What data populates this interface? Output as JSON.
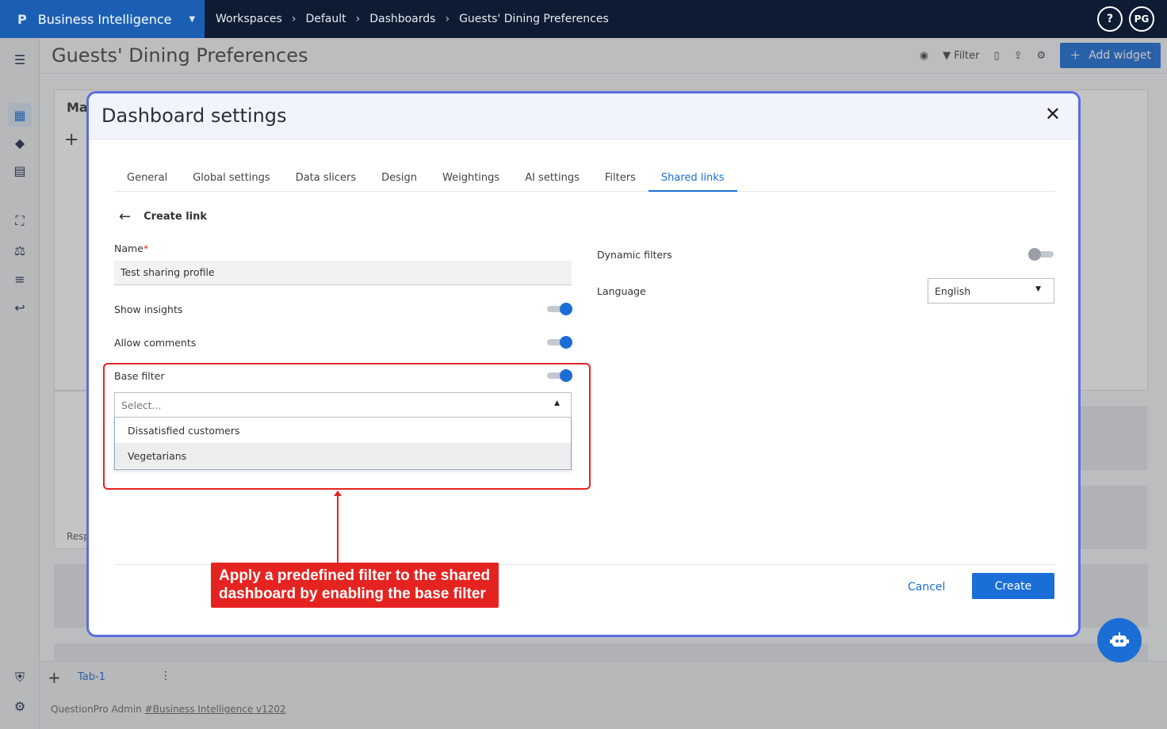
{
  "topbar": {
    "app_name": "Business Intelligence",
    "breadcrumbs": [
      "Workspaces",
      "Default",
      "Dashboards",
      "Guests' Dining Preferences"
    ],
    "help_label": "?",
    "avatar_initials": "PG"
  },
  "subheader": {
    "page_title": "Guests' Dining Preferences",
    "filter_label": "Filter",
    "add_widget_label": "Add widget"
  },
  "background": {
    "widget_title_fragment": "Ma",
    "widget_footer_fragment": "Resp",
    "tab_name": "Tab-1",
    "footer_text": "QuestionPro Admin ",
    "footer_link": "#Business Intelligence v1202"
  },
  "modal": {
    "title": "Dashboard settings",
    "close_label": "✕",
    "tabs": [
      {
        "label": "General",
        "active": false
      },
      {
        "label": "Global settings",
        "active": false
      },
      {
        "label": "Data slicers",
        "active": false
      },
      {
        "label": "Design",
        "active": false
      },
      {
        "label": "Weightings",
        "active": false
      },
      {
        "label": "AI settings",
        "active": false
      },
      {
        "label": "Filters",
        "active": false
      },
      {
        "label": "Shared links",
        "active": true
      }
    ],
    "create_link_label": "Create link",
    "name_label": "Name",
    "name_required_mark": "*",
    "name_value": "Test sharing profile",
    "show_insights_label": "Show insights",
    "show_insights_on": true,
    "allow_comments_label": "Allow comments",
    "allow_comments_on": true,
    "base_filter_label": "Base filter",
    "base_filter_on": true,
    "base_filter_placeholder": "Select...",
    "base_filter_options": [
      "Dissatisfied customers",
      "Vegetarians"
    ],
    "dynamic_filters_label": "Dynamic filters",
    "dynamic_filters_on": false,
    "language_label": "Language",
    "language_value": "English",
    "cancel_label": "Cancel",
    "create_label": "Create"
  },
  "callout": {
    "line1": "Apply a predefined filter to the shared",
    "line2": "dashboard by enabling the base filter"
  },
  "colors": {
    "accent": "#1b6ed6",
    "topbar": "#0d1b33",
    "brand": "#1b5fb5",
    "highlight": "#e52421"
  }
}
